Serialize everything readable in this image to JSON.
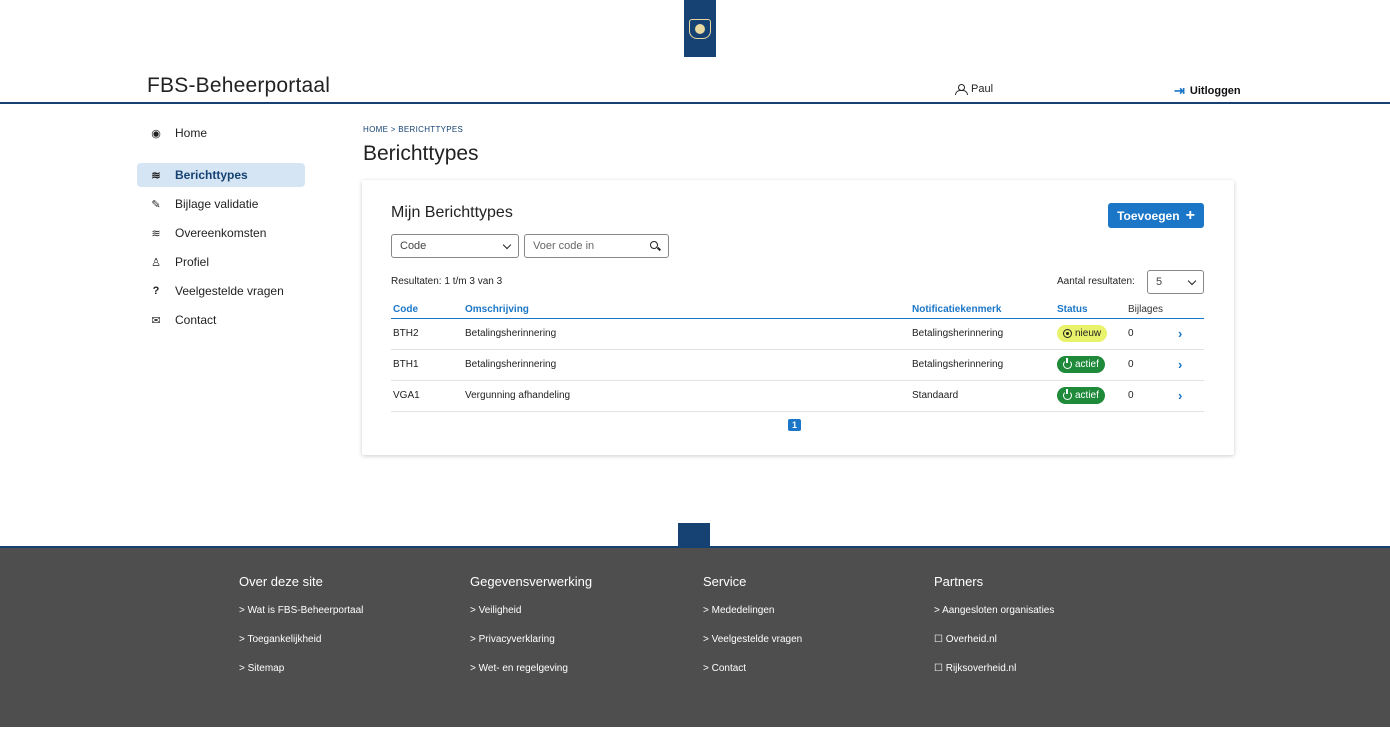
{
  "header": {
    "app_title": "FBS-Beheerportaal",
    "user_name": "Paul",
    "logout_label": "Uitloggen"
  },
  "sidebar": {
    "items": [
      {
        "label": "Home",
        "icon": "radio-dot-icon"
      },
      {
        "label": "Berichttypes",
        "icon": "layers-icon",
        "active": true
      },
      {
        "label": "Bijlage validatie",
        "icon": "paperclip-icon"
      },
      {
        "label": "Overeenkomsten",
        "icon": "layers-icon"
      },
      {
        "label": "Profiel",
        "icon": "user-icon"
      },
      {
        "label": "Veelgestelde vragen",
        "icon": "question-icon"
      },
      {
        "label": "Contact",
        "icon": "chat-icon"
      }
    ]
  },
  "breadcrumb": {
    "home": "HOME",
    "separator": ">",
    "current": "BERICHTTYPES"
  },
  "page_title": "Berichttypes",
  "card": {
    "title": "Mijn Berichttypes",
    "add_label": "Toevoegen",
    "filter_select": "Code",
    "search_placeholder": "Voer code in",
    "results_text": "Resultaten: 1 t/m 3 van 3",
    "page_size_label": "Aantal resultaten:",
    "page_size_value": "5",
    "columns": [
      "Code",
      "Omschrijving",
      "Notificatiekenmerk",
      "Status",
      "Bijlages"
    ],
    "rows": [
      {
        "code": "BTH2",
        "omschrijving": "Betalingsherinnering",
        "notificatiekenmerk": "Betalingsherinnering",
        "status": "nieuw",
        "bijlages": "0"
      },
      {
        "code": "BTH1",
        "omschrijving": "Betalingsherinnering",
        "notificatiekenmerk": "Betalingsherinnering",
        "status": "actief",
        "bijlages": "0"
      },
      {
        "code": "VGA1",
        "omschrijving": "Vergunning afhandeling",
        "notificatiekenmerk": "Standaard",
        "status": "actief",
        "bijlages": "0"
      }
    ],
    "current_page": "1"
  },
  "footer": {
    "columns": [
      {
        "title": "Over deze site",
        "links": [
          "> Wat is FBS-Beheerportaal",
          "> Toegankelijkheid",
          "> Sitemap"
        ]
      },
      {
        "title": "Gegevensverwerking",
        "links": [
          "> Veiligheid",
          "> Privacyverklaring",
          "> Wet- en regelgeving"
        ]
      },
      {
        "title": "Service",
        "links": [
          "> Mededelingen",
          "> Veelgestelde vragen",
          "> Contact"
        ]
      },
      {
        "title": "Partners",
        "links": [
          "> Aangesloten organisaties",
          "☐ Overheid.nl",
          "☐ Rijksoverheid.nl"
        ]
      }
    ]
  },
  "colors": {
    "brand": "#154273",
    "accent": "#1b76c8",
    "status_new": "#e9f26b",
    "status_active": "#1e8a3a",
    "footer_bg": "#4e4e4e"
  }
}
